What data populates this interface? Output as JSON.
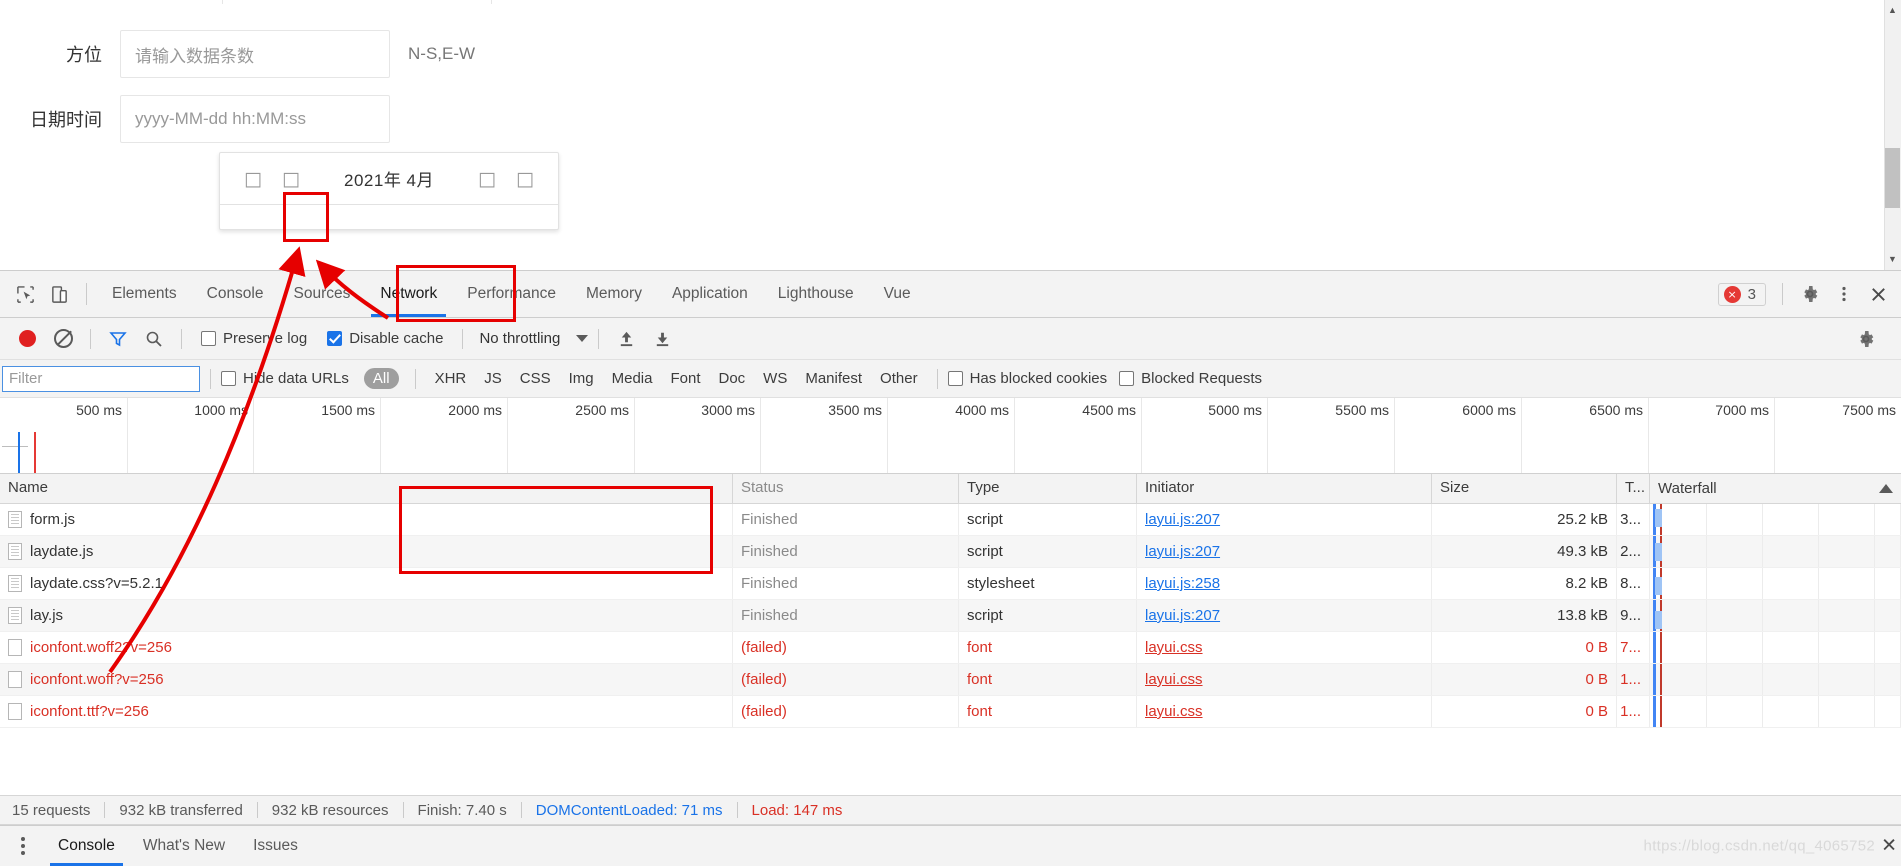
{
  "page": {
    "fields": [
      {
        "label": "方位",
        "placeholder": "请输入数据条数",
        "hint": "N-S,E-W"
      },
      {
        "label": "日期时间",
        "placeholder": "yyyy-MM-dd hh:MM:ss",
        "hint": ""
      }
    ],
    "datepicker": {
      "prev_year_icon": "□",
      "prev_month_icon": "□",
      "title": "2021年  4月",
      "next_month_icon": "□",
      "next_year_icon": "□"
    }
  },
  "devtools": {
    "inspect_icon": "inspect-element-icon",
    "device_icon": "device-toolbar-icon",
    "tabs": [
      {
        "label": "Elements",
        "active": false
      },
      {
        "label": "Console",
        "active": false
      },
      {
        "label": "Sources",
        "active": false
      },
      {
        "label": "Network",
        "active": true
      },
      {
        "label": "Performance",
        "active": false
      },
      {
        "label": "Memory",
        "active": false
      },
      {
        "label": "Application",
        "active": false
      },
      {
        "label": "Lighthouse",
        "active": false
      },
      {
        "label": "Vue",
        "active": false
      }
    ],
    "error_badge": {
      "icon": "×",
      "count": "3"
    },
    "settings_icon": "gear-icon",
    "more_icon": "kebab-menu-icon",
    "close_icon": "close-icon",
    "toolbar": {
      "record_label": "record-button",
      "clear_label": "clear-button",
      "filter_icon": "filter-funnel-icon",
      "search_icon": "search-icon",
      "preserve_log": {
        "label": "Preserve log",
        "checked": false
      },
      "disable_cache": {
        "label": "Disable cache",
        "checked": true
      },
      "throttling": "No throttling",
      "import_icon": "import-har-icon",
      "export_icon": "export-har-icon",
      "net_settings_icon": "network-settings-gear-icon"
    },
    "filters": {
      "search_placeholder": "Filter",
      "search_value": "",
      "hide_data_urls": {
        "label": "Hide data URLs",
        "checked": false
      },
      "types": [
        "All",
        "XHR",
        "JS",
        "CSS",
        "Img",
        "Media",
        "Font",
        "Doc",
        "WS",
        "Manifest",
        "Other"
      ],
      "active_type": "All",
      "has_blocked_cookies": {
        "label": "Has blocked cookies",
        "checked": false
      },
      "blocked_requests": {
        "label": "Blocked Requests",
        "checked": false
      }
    },
    "overview": {
      "ticks": [
        "500 ms",
        "1000 ms",
        "1500 ms",
        "2000 ms",
        "2500 ms",
        "3000 ms",
        "3500 ms",
        "4000 ms",
        "4500 ms",
        "5000 ms",
        "5500 ms",
        "6000 ms",
        "6500 ms",
        "7000 ms",
        "7500 ms"
      ]
    },
    "table": {
      "columns": [
        "Name",
        "Status",
        "Type",
        "Initiator",
        "Size",
        "T...",
        "Waterfall"
      ],
      "rows": [
        {
          "name": "form.js",
          "status": "Finished",
          "type": "script",
          "initiator": "layui.js:207",
          "size": "25.2 kB",
          "time": "3...",
          "failed": false
        },
        {
          "name": "laydate.js",
          "status": "Finished",
          "type": "script",
          "initiator": "layui.js:207",
          "size": "49.3 kB",
          "time": "2...",
          "failed": false
        },
        {
          "name": "laydate.css?v=5.2.1",
          "status": "Finished",
          "type": "stylesheet",
          "initiator": "layui.js:258",
          "size": "8.2 kB",
          "time": "8...",
          "failed": false
        },
        {
          "name": "lay.js",
          "status": "Finished",
          "type": "script",
          "initiator": "layui.js:207",
          "size": "13.8 kB",
          "time": "9...",
          "failed": false
        },
        {
          "name": "iconfont.woff2?v=256",
          "status": "(failed)",
          "type": "font",
          "initiator": "layui.css",
          "size": "0 B",
          "time": "7...",
          "failed": true
        },
        {
          "name": "iconfont.woff?v=256",
          "status": "(failed)",
          "type": "font",
          "initiator": "layui.css",
          "size": "0 B",
          "time": "1...",
          "failed": true
        },
        {
          "name": "iconfont.ttf?v=256",
          "status": "(failed)",
          "type": "font",
          "initiator": "layui.css",
          "size": "0 B",
          "time": "1...",
          "failed": true
        }
      ]
    },
    "summary": {
      "requests": "15 requests",
      "transferred": "932 kB transferred",
      "resources": "932 kB resources",
      "finish": "Finish: 7.40 s",
      "dom_content_loaded": "DOMContentLoaded: 71 ms",
      "load": "Load: 147 ms"
    },
    "drawer": {
      "tabs": [
        {
          "label": "Console",
          "active": true
        },
        {
          "label": "What's New",
          "active": false
        },
        {
          "label": "Issues",
          "active": false
        }
      ]
    }
  },
  "watermark": {
    "text": "https://blog.csdn.net/qq_4065752",
    "close_icon": "✕"
  },
  "colors": {
    "accent": "#1a73e8",
    "error": "#d93025",
    "annotation": "#e60000"
  }
}
